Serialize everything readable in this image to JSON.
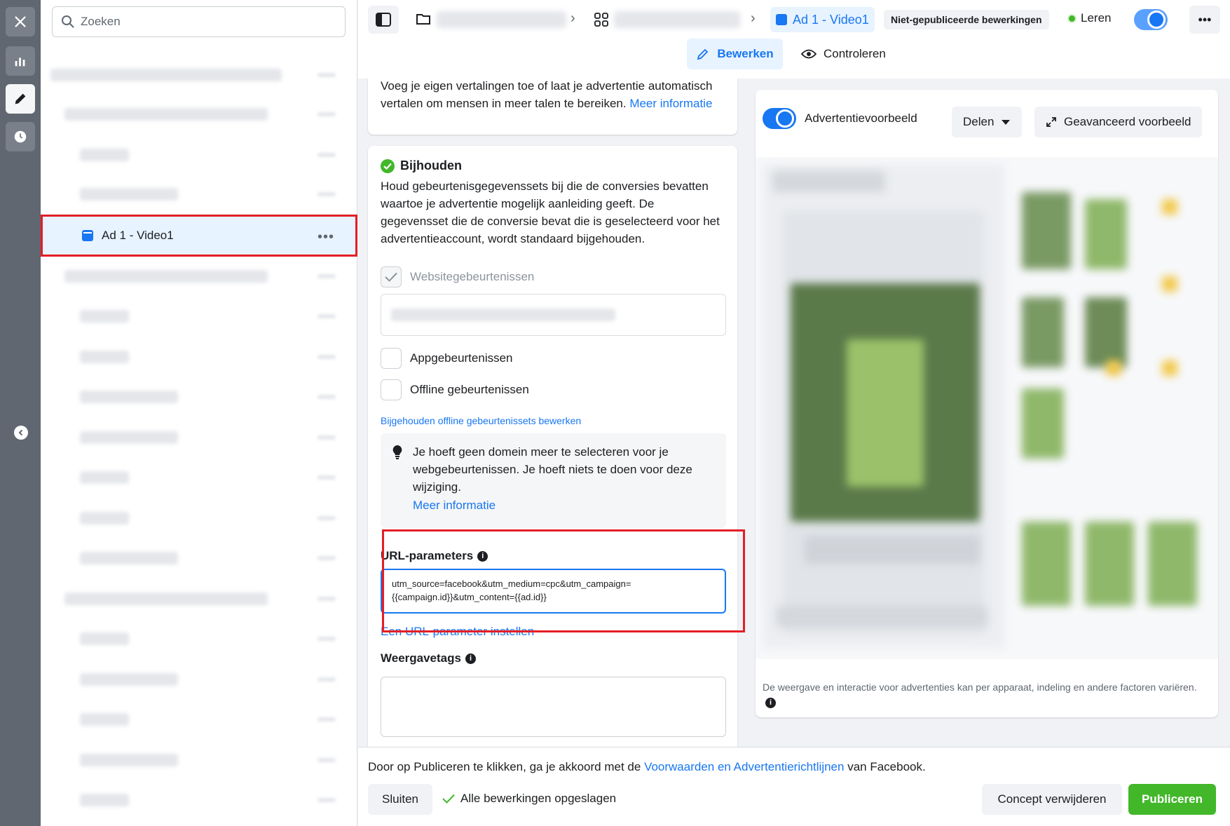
{
  "search": {
    "placeholder": "Zoeken"
  },
  "tree": {
    "selected_label": "Ad 1 - Video1",
    "more": "•••"
  },
  "header": {
    "crumb_ad": "Ad 1 - Video1",
    "badge": "Niet-gepubliceerde bewerkingen",
    "learn": "Leren",
    "more": "•••",
    "tab_edit": "Bewerken",
    "tab_review": "Controleren"
  },
  "form": {
    "translations_text": "Voeg je eigen vertalingen toe of laat je advertentie automatisch vertalen om mensen in meer talen te bereiken.",
    "translations_link": "Meer informatie",
    "tracking_title": "Bijhouden",
    "tracking_desc": "Houd gebeurtenisgegevenssets bij die de conversies bevatten waartoe je advertentie mogelijk aanleiding geeft. De gegevensset die de conversie bevat die is geselecteerd voor het advertentieaccount, wordt standaard bijgehouden.",
    "website_events": "Websitegebeurtenissen",
    "app_events": "Appgebeurtenissen",
    "offline_events": "Offline gebeurtenissen",
    "edit_offline_link": "Bijgehouden offline gebeurtenissets bewerken",
    "notice_text": "Je hoeft geen domein meer te selecteren voor je webgebeurtenissen. Je hoeft niets te doen voor deze wijziging.",
    "notice_link": "Meer informatie",
    "url_params_label": "URL-parameters",
    "url_params_value": "utm_source=facebook&utm_medium=cpc&utm_campaign={{campaign.id}}&utm_content={{ad.id}}",
    "url_params_link": "Een URL-parameter instellen",
    "display_tags_label": "Weergavetags"
  },
  "preview": {
    "toggle_label": "Advertentievoorbeeld",
    "share_label": "Delen",
    "advanced_label": "Geavanceerd voorbeeld",
    "note": "De weergave en interactie voor advertenties kan per apparaat, indeling en andere factoren variëren."
  },
  "footer": {
    "terms_prefix": "Door op Publiceren te klikken, ga je akkoord met de",
    "terms_link": "Voorwaarden en Advertentierichtlijnen",
    "terms_suffix": "van Facebook.",
    "close": "Sluiten",
    "saved": "Alle bewerkingen opgeslagen",
    "delete_draft": "Concept verwijderen",
    "publish": "Publiceren"
  }
}
